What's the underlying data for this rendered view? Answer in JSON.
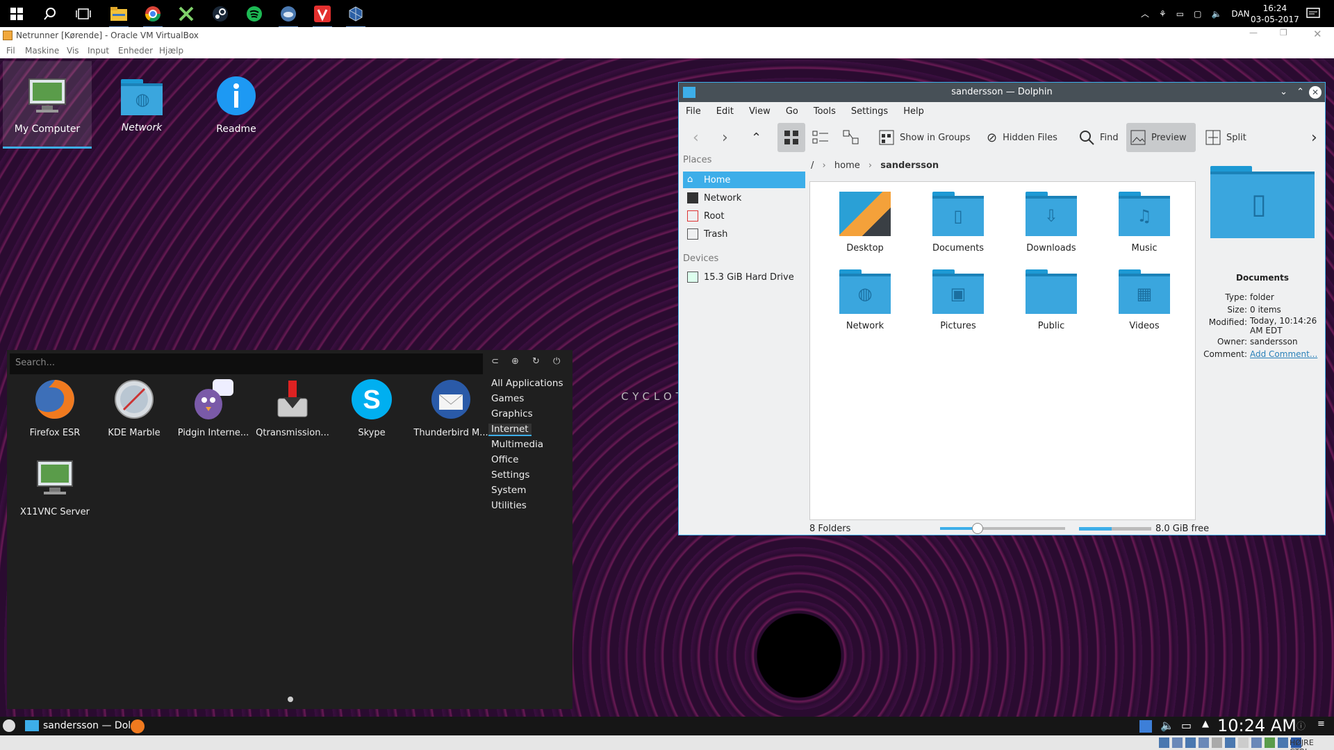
{
  "win_taskbar": {
    "apps": [
      "start-icon",
      "search-icon",
      "task-view-icon",
      "file-explorer-icon",
      "chrome-icon",
      "tool-icon",
      "steam-icon",
      "spotify-icon",
      "cloud-icon",
      "vivaldi-icon",
      "virtualbox-icon"
    ],
    "lang": "DAN",
    "time": "16:24",
    "date": "03-05-2017"
  },
  "vbox": {
    "title": "Netrunner [Kørende] - Oracle VM VirtualBox",
    "menu": [
      "Fil",
      "Maskine",
      "Vis",
      "Input",
      "Enheder",
      "Hjælp"
    ]
  },
  "desktop": {
    "icons": [
      {
        "label": "My Computer"
      },
      {
        "label": "Network"
      },
      {
        "label": "Readme"
      }
    ],
    "wallpaper_text": "CYCLOT"
  },
  "launcher": {
    "search_placeholder": "Search...",
    "apps": [
      {
        "label": "Firefox ESR"
      },
      {
        "label": "KDE Marble"
      },
      {
        "label": "Pidgin Interne..."
      },
      {
        "label": "Qtransmission..."
      },
      {
        "label": "Skype"
      },
      {
        "label": "Thunderbird M..."
      },
      {
        "label": "X11VNC Server"
      }
    ],
    "categories": [
      "All Applications",
      "Games",
      "Graphics",
      "Internet",
      "Multimedia",
      "Office",
      "Settings",
      "System",
      "Utilities"
    ],
    "selected_category": "Internet"
  },
  "dolphin": {
    "title": "sandersson — Dolphin",
    "menu": [
      "File",
      "Edit",
      "View",
      "Go",
      "Tools",
      "Settings",
      "Help"
    ],
    "toolbar": {
      "show_in_groups": "Show in Groups",
      "hidden_files": "Hidden Files",
      "find": "Find",
      "preview": "Preview",
      "split": "Split"
    },
    "places_header": "Places",
    "places": [
      "Home",
      "Network",
      "Root",
      "Trash"
    ],
    "devices_header": "Devices",
    "devices": [
      "15.3 GiB Hard Drive"
    ],
    "breadcrumb": {
      "root": "/",
      "home": "home",
      "user": "sandersson"
    },
    "folders": [
      "Desktop",
      "Documents",
      "Downloads",
      "Music",
      "Network",
      "Pictures",
      "Public",
      "Videos"
    ],
    "info": {
      "name": "Documents",
      "type_label": "Type:",
      "type": "folder",
      "size_label": "Size:",
      "size": "0 items",
      "modified_label": "Modified:",
      "modified": "Today, 10:14:26 AM EDT",
      "owner_label": "Owner:",
      "owner": "sandersson",
      "comment_label": "Comment:",
      "comment": "Add Comment..."
    },
    "status": {
      "count": "8 Folders",
      "free": "8.0 GiB free",
      "zoom": 0.3,
      "disk_used": 0.45
    }
  },
  "kde_panel": {
    "task": "sandersson — Dol...",
    "time": "10:24 AM"
  },
  "vbox_status": {
    "host_key": "HØJRE CTRL"
  },
  "colors": {
    "accent": "#3daee9",
    "folder": "#3aa6de"
  }
}
